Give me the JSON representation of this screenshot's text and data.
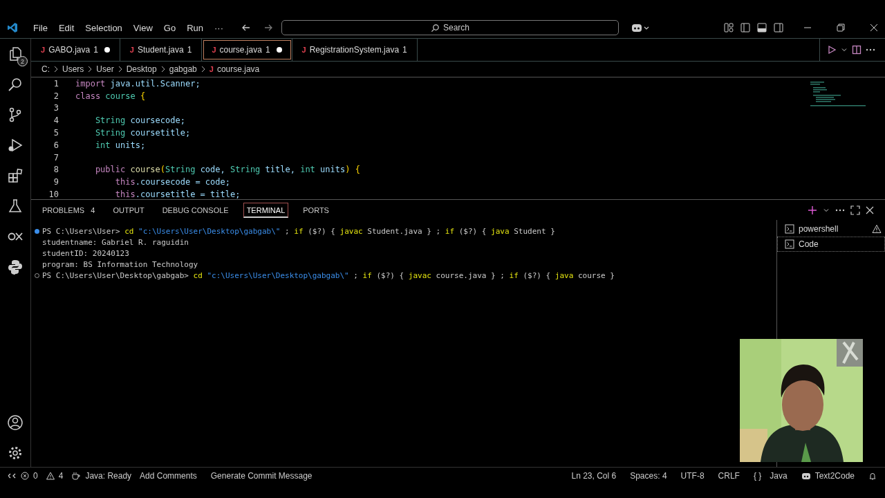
{
  "menu": [
    "File",
    "Edit",
    "Selection",
    "View",
    "Go",
    "Run",
    "···"
  ],
  "search": {
    "placeholder": "Search"
  },
  "explorer_badge": "2",
  "tabs": [
    {
      "icon": "J",
      "label": "GABO.java",
      "badge": "1",
      "modified": true,
      "selected": false
    },
    {
      "icon": "J",
      "label": "Student.java",
      "badge": "1",
      "modified": false,
      "selected": false
    },
    {
      "icon": "J",
      "label": "course.java",
      "badge": "1",
      "modified": true,
      "selected": true
    },
    {
      "icon": "J",
      "label": "RegistrationSystem.java",
      "badge": "1",
      "modified": false,
      "selected": false
    }
  ],
  "breadcrumb": [
    {
      "label": "C:"
    },
    {
      "label": "Users"
    },
    {
      "label": "User"
    },
    {
      "label": "Desktop"
    },
    {
      "label": "gabgab"
    },
    {
      "icon": "J",
      "label": "course.java"
    }
  ],
  "code": [
    {
      "num": "1",
      "tokens": [
        {
          "t": "import",
          "kind": "kw"
        },
        {
          "t": " java.util.Scanner;",
          "kind": "name"
        }
      ]
    },
    {
      "num": "2",
      "tokens": [
        {
          "t": "class",
          "kind": "kw"
        },
        {
          "t": " course ",
          "kind": "type"
        },
        {
          "t": "{",
          "kind": "brace"
        }
      ]
    },
    {
      "num": "3"
    },
    {
      "num": "4",
      "tokens": [
        {
          "t": "    String",
          "kind": "type"
        },
        {
          "t": " coursecode;",
          "kind": "name"
        }
      ]
    },
    {
      "num": "5",
      "tokens": [
        {
          "t": "    String",
          "kind": "type"
        },
        {
          "t": " coursetitle;",
          "kind": "name"
        }
      ]
    },
    {
      "num": "6",
      "tokens": [
        {
          "t": "    int",
          "kind": "type"
        },
        {
          "t": " units;",
          "kind": "name"
        }
      ]
    },
    {
      "num": "7"
    },
    {
      "num": "8",
      "tokens": [
        {
          "t": "    public",
          "kind": "kw"
        },
        {
          "t": " course",
          "kind": "func"
        },
        {
          "t": "(",
          "kind": "brace"
        },
        {
          "t": "String",
          "kind": "type"
        },
        {
          "t": " code, ",
          "kind": "name"
        },
        {
          "t": "String",
          "kind": "type"
        },
        {
          "t": " title, ",
          "kind": "name"
        },
        {
          "t": "int",
          "kind": "type"
        },
        {
          "t": " units",
          "kind": "name"
        },
        {
          "t": ") {",
          "kind": "brace"
        }
      ]
    },
    {
      "num": "9",
      "tokens": [
        {
          "t": "        this",
          "kind": "kw"
        },
        {
          "t": ".coursecode = code;",
          "kind": "name"
        }
      ]
    },
    {
      "num": "10",
      "tokens": [
        {
          "t": "        this",
          "kind": "kw"
        },
        {
          "t": ".coursetitle = title;",
          "kind": "name"
        }
      ]
    }
  ],
  "panel_tabs": [
    {
      "label": "PROBLEMS",
      "count": "4",
      "selected": false
    },
    {
      "label": "OUTPUT",
      "selected": false
    },
    {
      "label": "DEBUG CONSOLE",
      "selected": false
    },
    {
      "label": "TERMINAL",
      "selected": true
    },
    {
      "label": "PORTS",
      "selected": false
    }
  ],
  "terminal": [
    {
      "kind": "done",
      "tokens": [
        {
          "t": "PS C:\\Users\\User> ",
          "kind": "plain"
        },
        {
          "t": "cd ",
          "kind": "cmd"
        },
        {
          "t": "\"c:\\Users\\User\\Desktop\\gabgab\\\"",
          "kind": "str"
        },
        {
          "t": " ; ",
          "kind": "plain"
        },
        {
          "t": "if",
          "kind": "cmd"
        },
        {
          "t": " ($?) { ",
          "kind": "plain"
        },
        {
          "t": "javac",
          "kind": "cmd"
        },
        {
          "t": " Student.java } ; ",
          "kind": "plain"
        },
        {
          "t": "if",
          "kind": "cmd"
        },
        {
          "t": " ($?) { ",
          "kind": "plain"
        },
        {
          "t": "java",
          "kind": "cmd"
        },
        {
          "t": " Student }",
          "kind": "plain"
        }
      ]
    },
    {
      "kind": "output",
      "tokens": [
        {
          "t": "studentname: Gabriel R. raguidin",
          "kind": "plain"
        }
      ]
    },
    {
      "kind": "output",
      "tokens": [
        {
          "t": "studentID: 20240123",
          "kind": "plain"
        }
      ]
    },
    {
      "kind": "output",
      "tokens": [
        {
          "t": "program: BS Information Technology",
          "kind": "plain"
        }
      ]
    },
    {
      "kind": "running",
      "tokens": [
        {
          "t": "PS C:\\Users\\User\\Desktop\\gabgab> ",
          "kind": "plain"
        },
        {
          "t": "cd ",
          "kind": "cmd"
        },
        {
          "t": "\"c:\\Users\\User\\Desktop\\gabgab\\\"",
          "kind": "str"
        },
        {
          "t": " ; ",
          "kind": "plain"
        },
        {
          "t": "if",
          "kind": "cmd"
        },
        {
          "t": " ($?) { ",
          "kind": "plain"
        },
        {
          "t": "javac",
          "kind": "cmd"
        },
        {
          "t": " course.java } ; ",
          "kind": "plain"
        },
        {
          "t": "if",
          "kind": "cmd"
        },
        {
          "t": " ($?) { ",
          "kind": "plain"
        },
        {
          "t": "java",
          "kind": "cmd"
        },
        {
          "t": " course }",
          "kind": "plain"
        }
      ]
    }
  ],
  "terminals": [
    {
      "label": "powershell",
      "warning": true,
      "selected": false
    },
    {
      "label": "Code",
      "warning": false,
      "selected": true
    }
  ],
  "status_left": [
    {
      "label": "0",
      "kind": "errors"
    },
    {
      "label": "4",
      "kind": "warnings"
    },
    {
      "label": "Java: Ready",
      "kind": "java"
    },
    {
      "label": "Add Comments",
      "kind": "text"
    },
    {
      "label": "Generate Commit Message",
      "kind": "text"
    }
  ],
  "status_right": [
    {
      "label": "Ln 23, Col 6",
      "kind": "text"
    },
    {
      "label": "Spaces: 4",
      "kind": "text"
    },
    {
      "label": "UTF-8",
      "kind": "text"
    },
    {
      "label": "CRLF",
      "kind": "text"
    },
    {
      "icon": "{ }",
      "label": "Java",
      "kind": "braces"
    },
    {
      "label": "Text2Code",
      "kind": "copilot"
    }
  ]
}
